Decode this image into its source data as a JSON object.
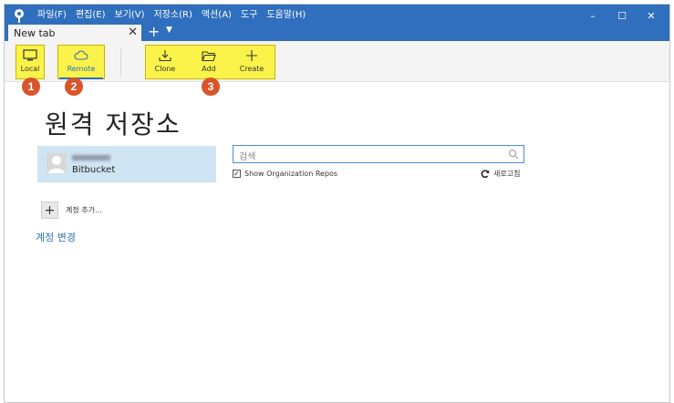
{
  "menu": [
    "파일(F)",
    "편집(E)",
    "보기(V)",
    "저장소(R)",
    "액션(A)",
    "도구",
    "도움말(H)"
  ],
  "window_controls": {
    "minimize": "–",
    "maximize": "☐",
    "close": "✕"
  },
  "tab": {
    "label": "New tab",
    "close": "✕",
    "new": "+",
    "dropdown": "▼"
  },
  "toolbar": {
    "local": "Local",
    "remote": "Remote",
    "clone": "Clone",
    "add": "Add",
    "create": "Create"
  },
  "badges": [
    "1",
    "2",
    "3"
  ],
  "page": {
    "title": "원격 저장소"
  },
  "account": {
    "service": "Bitbucket"
  },
  "add_account": {
    "icon": "+",
    "label": "계정 추가..."
  },
  "change_account": "계정 변경",
  "search": {
    "placeholder": "검색"
  },
  "org_repos": {
    "label": "Show Organization Repos",
    "checked": "✓"
  },
  "refresh": {
    "label": "새로고침"
  },
  "colors": {
    "accent": "#2f6fbd",
    "highlight": "#fbf34a",
    "badge": "#d9542b",
    "selected": "#cfe5f3"
  }
}
